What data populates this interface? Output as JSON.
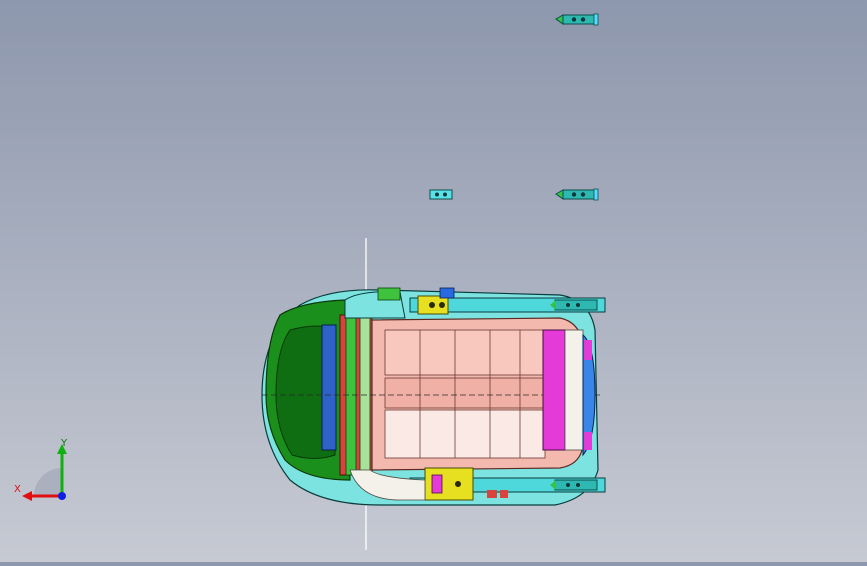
{
  "viewport": {
    "background_top": "#8d97ad",
    "background_bottom": "#c7cad3"
  },
  "triad": {
    "x_label": "X",
    "y_label": "Y",
    "x_color": "#e01010",
    "y_color": "#10b010",
    "z_color": "#1020e0"
  },
  "model": {
    "name": "seat-assembly",
    "colors": {
      "headrest_green": "#1a8a1a",
      "cushion_pink": "#f2b8ae",
      "rail_cyan": "#4fd9de",
      "accent_magenta": "#e23ad6",
      "bracket_yellow": "#e7e021",
      "clip_blue": "#2a6ae0"
    }
  },
  "fasteners": [
    {
      "name": "clip-top"
    },
    {
      "name": "clip-mid-right"
    },
    {
      "name": "clip-mid-left"
    }
  ]
}
